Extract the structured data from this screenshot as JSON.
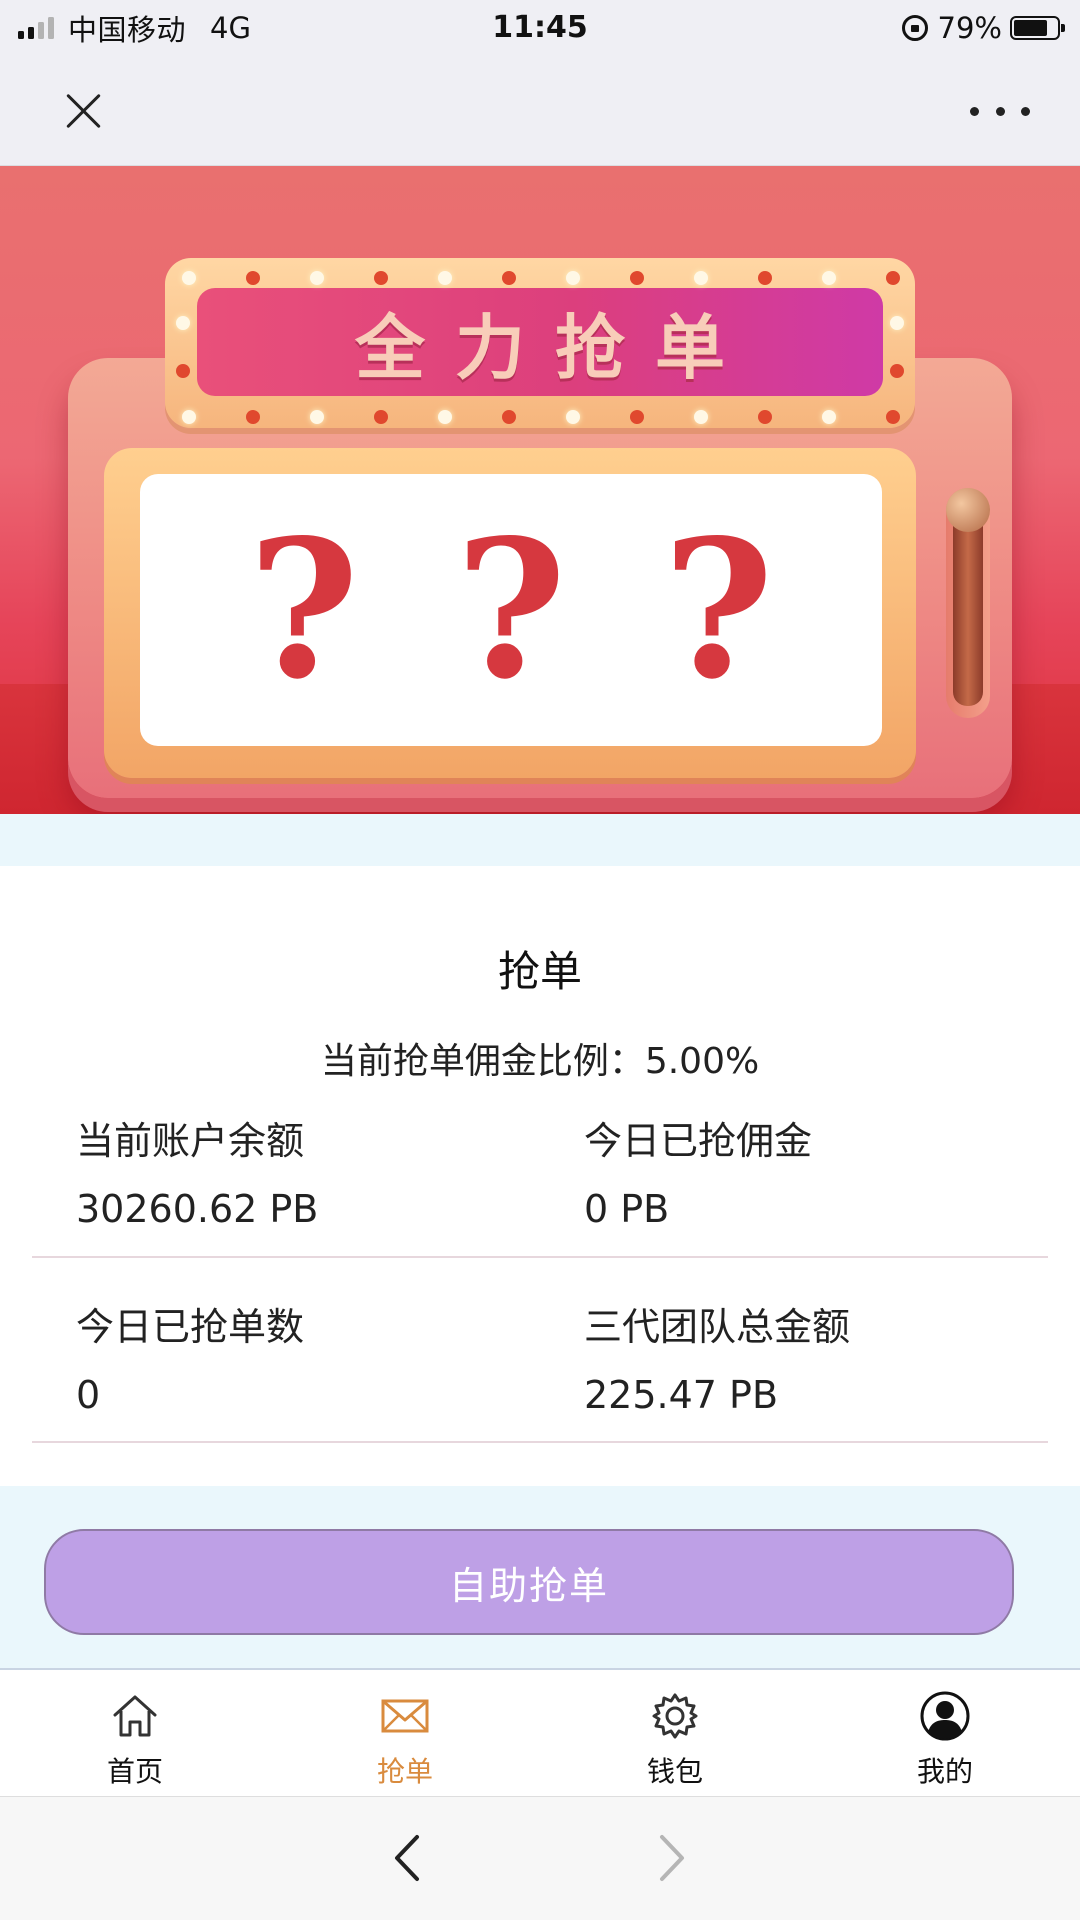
{
  "status_bar": {
    "carrier": "中国移动",
    "network": "4G",
    "time": "11:45",
    "battery_percent": "79%",
    "battery_level": 0.79,
    "signal_icon": "signal-bars-icon",
    "rotation_lock_icon": "rotation-lock-icon",
    "battery_icon": "battery-icon"
  },
  "nav_bar": {
    "close_icon": "close-icon",
    "more_icon": "more-icon"
  },
  "banner": {
    "marquee_title": "全力抢单",
    "reels": [
      "?",
      "?",
      "?"
    ]
  },
  "card": {
    "title": "抢单",
    "commission_rate_text": "当前抢单佣金比例：5.00%",
    "stats": [
      {
        "label": "当前账户余额",
        "value": "30260.62 PB"
      },
      {
        "label": "今日已抢佣金",
        "value": "0 PB"
      },
      {
        "label": "今日已抢单数",
        "value": "0"
      },
      {
        "label": "三代团队总金额",
        "value": "225.47 PB"
      }
    ]
  },
  "action": {
    "self_grab_label": "自助抢单",
    "color": "#bea0e6"
  },
  "tab_bar": {
    "active_color": "#d98b3e",
    "tabs": [
      {
        "label": "首页",
        "icon": "home-icon",
        "active": false
      },
      {
        "label": "抢单",
        "icon": "envelope-icon",
        "active": true
      },
      {
        "label": "钱包",
        "icon": "gear-icon",
        "active": false
      },
      {
        "label": "我的",
        "icon": "user-avatar-icon",
        "active": false
      }
    ]
  },
  "browser_bar": {
    "back_icon": "back-arrow-icon",
    "forward_icon": "forward-arrow-icon"
  }
}
